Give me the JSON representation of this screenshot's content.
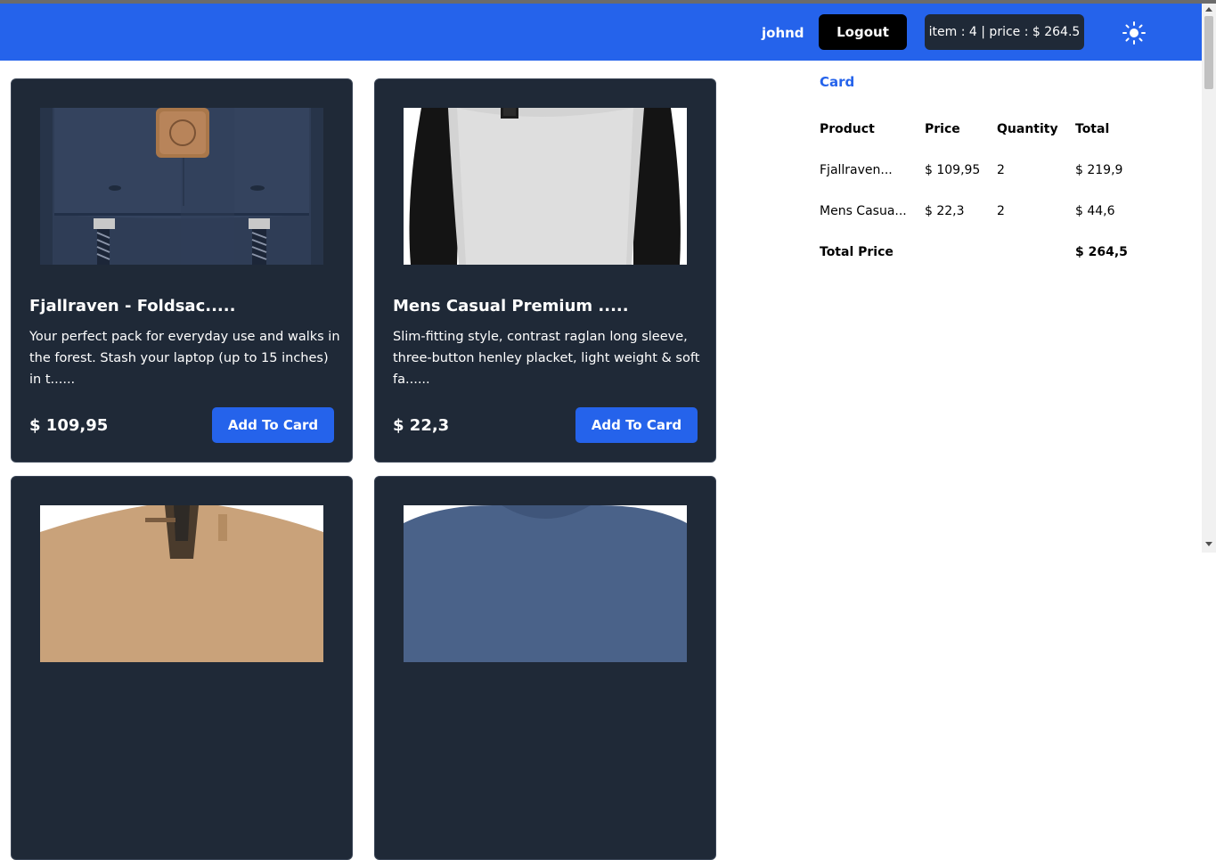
{
  "header": {
    "username": "johnd",
    "logout_label": "Logout",
    "cart_summary": "item : 4 | price : $ 264.5",
    "theme_icon": "sun-icon",
    "background_color": "#2563eb"
  },
  "products": [
    {
      "title": "Fjallraven - Foldsac.....",
      "description": "Your perfect pack for everyday use and walks in the forest. Stash your laptop (up to 15 inches) in t......",
      "price": "$ 109,95",
      "button_label": "Add To Card"
    },
    {
      "title": "Mens Casual Premium .....",
      "description": "Slim-fitting style, contrast raglan long sleeve, three-button henley placket, light weight & soft fa......",
      "price": "$ 22,3",
      "button_label": "Add To Card"
    }
  ],
  "cart": {
    "title": "Card",
    "headers": [
      "Product",
      "Price",
      "Quantity",
      "Total"
    ],
    "rows": [
      {
        "product": "Fjallraven...",
        "price": "$ 109,95",
        "quantity": "2",
        "total": "$ 219,9"
      },
      {
        "product": "Mens Casua...",
        "price": "$ 22,3",
        "quantity": "2",
        "total": "$ 44,6"
      }
    ],
    "total_label": "Total Price",
    "total_value": "$ 264,5"
  }
}
